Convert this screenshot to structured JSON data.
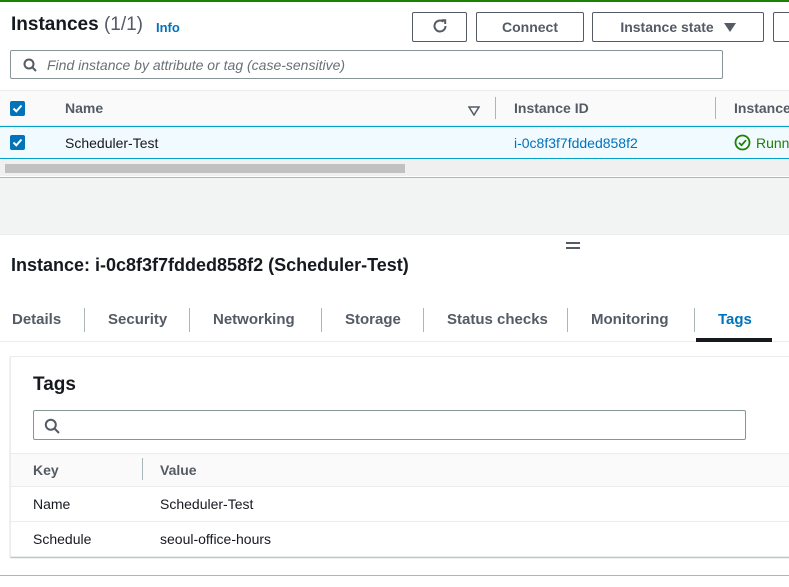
{
  "header": {
    "title": "Instances",
    "count": "(1/1)",
    "info_link": "Info",
    "connect_label": "Connect",
    "instance_state_label": "Instance state"
  },
  "search": {
    "placeholder": "Find instance by attribute or tag (case-sensitive)"
  },
  "table": {
    "columns": [
      "Name",
      "Instance ID",
      "Instance"
    ],
    "rows": [
      {
        "name": "Scheduler-Test",
        "instance_id": "i-0c8f3f7fdded858f2",
        "state": "Runn",
        "selected": true
      }
    ]
  },
  "detail": {
    "title": "Instance: i-0c8f3f7fdded858f2 (Scheduler-Test)",
    "tabs": [
      "Details",
      "Security",
      "Networking",
      "Storage",
      "Status checks",
      "Monitoring",
      "Tags"
    ],
    "active_tab": "Tags"
  },
  "tags_panel": {
    "title": "Tags",
    "columns": [
      "Key",
      "Value"
    ],
    "rows": [
      {
        "key": "Name",
        "value": "Scheduler-Test"
      },
      {
        "key": "Schedule",
        "value": "seoul-office-hours"
      }
    ]
  },
  "colors": {
    "accent": "#0073bb",
    "success": "#1d8102",
    "text": "#16191f",
    "muted": "#545b64"
  },
  "icons": [
    "refresh-icon",
    "caret-down-icon",
    "search-icon",
    "checkbox-checked-icon",
    "sort-icon",
    "running-status-icon",
    "drag-handle-icon"
  ]
}
